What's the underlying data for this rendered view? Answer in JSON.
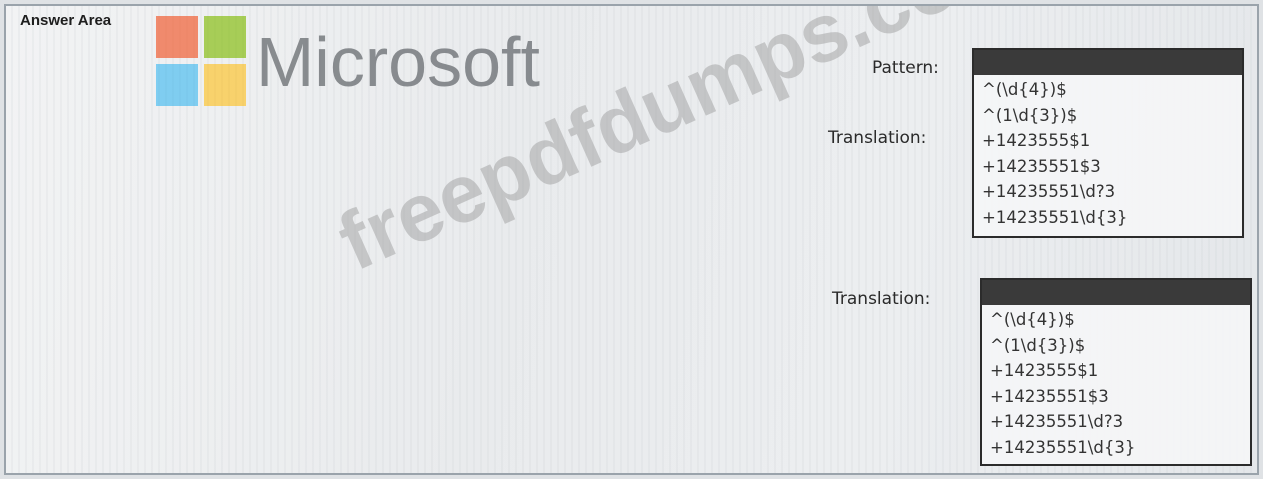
{
  "answer_area": "Answer Area",
  "logo": {
    "text": "Microsoft"
  },
  "watermark": "freepdfdumps.com",
  "pattern": {
    "label": "Pattern:",
    "options": [
      "^(\\d{4})$",
      "^(1\\d{3})$",
      "+1423555$1",
      "+14235551$3",
      "+14235551\\d?3",
      "+14235551\\d{3}"
    ]
  },
  "translation_overlap_label": "Translation:",
  "translation": {
    "label": "Translation:",
    "options": [
      "^(\\d{4})$",
      "^(1\\d{3})$",
      "+1423555$1",
      "+14235551$3",
      "+14235551\\d?3",
      "+14235551\\d{3}"
    ]
  }
}
